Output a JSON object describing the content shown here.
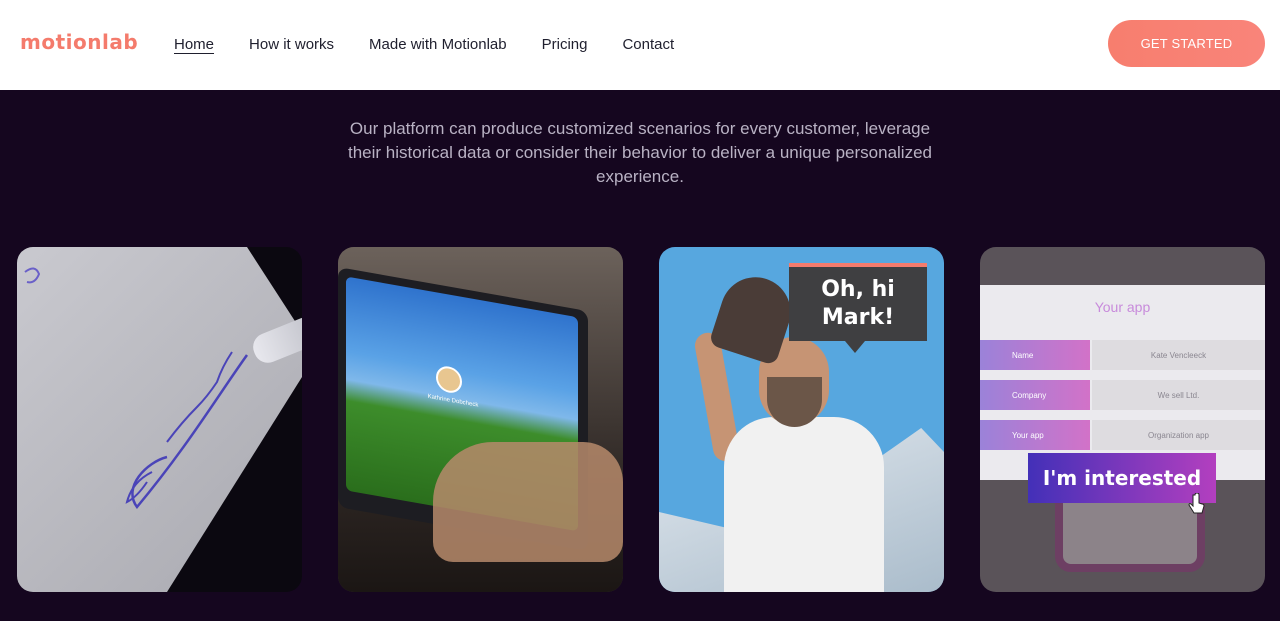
{
  "brand": {
    "logo": "motionlab",
    "accent": "#f47b6c"
  },
  "nav": {
    "items": [
      "Home",
      "How it works",
      "Made with Motionlab",
      "Pricing",
      "Contact"
    ],
    "active": "Home"
  },
  "header": {
    "cta_label": "GET STARTED"
  },
  "intro": {
    "text": "Our platform can produce customized scenarios for every customer, leverage their historical data or consider their behavior to deliver a unique personalized experience."
  },
  "cards": {
    "laptop": {
      "profile_name": "Kathrine Dobcheck"
    },
    "greeting": {
      "line1": "Oh, hi",
      "line2": "Mark!"
    },
    "app": {
      "title": "Your app",
      "rows": [
        {
          "label": "Name",
          "value": "Kate Vencleeck"
        },
        {
          "label": "Company",
          "value": "We sell Ltd."
        },
        {
          "label": "Your app",
          "value": "Organization app"
        }
      ],
      "button": "I'm interested"
    },
    "signature": {
      "text": "Johnson"
    }
  },
  "icons": {
    "cursor": "hand-pointer-icon",
    "avatar": "user-avatar-icon"
  }
}
